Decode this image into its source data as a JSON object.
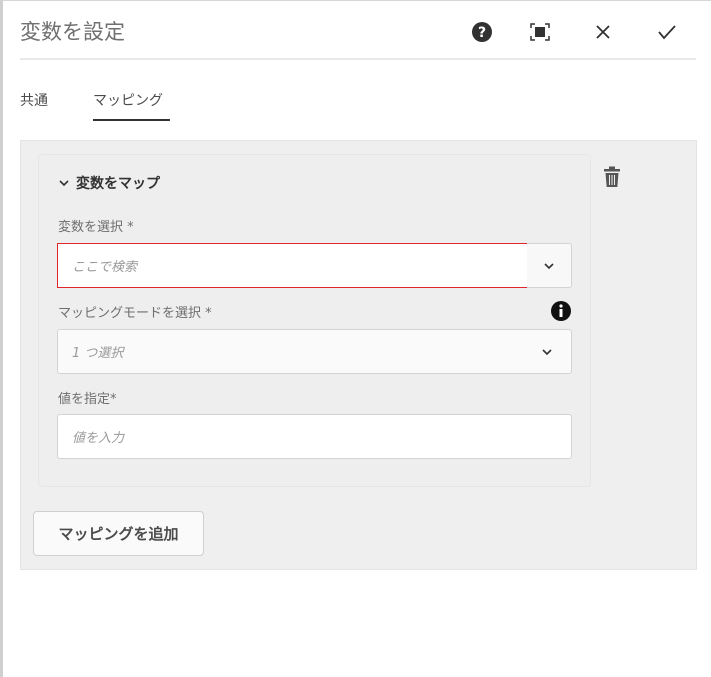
{
  "dialog": {
    "title": "変数を設定",
    "icons": [
      "help-icon",
      "fullscreen-icon",
      "close-icon",
      "check-icon"
    ]
  },
  "tabs": [
    {
      "label": "共通",
      "active": false
    },
    {
      "label": "マッピング",
      "active": true
    }
  ],
  "mapping": {
    "header": "変数をマップ",
    "variable_label": "変数を選択 *",
    "variable_placeholder": "ここで検索",
    "mode_label": "マッピングモードを選択 *",
    "mode_value": "1 つ選択",
    "value_label": "値を指定*",
    "value_placeholder": "値を入力"
  },
  "add_button": "マッピングを追加",
  "colors": {
    "error_border": "#e0262b",
    "panel_bg": "#efefef"
  }
}
